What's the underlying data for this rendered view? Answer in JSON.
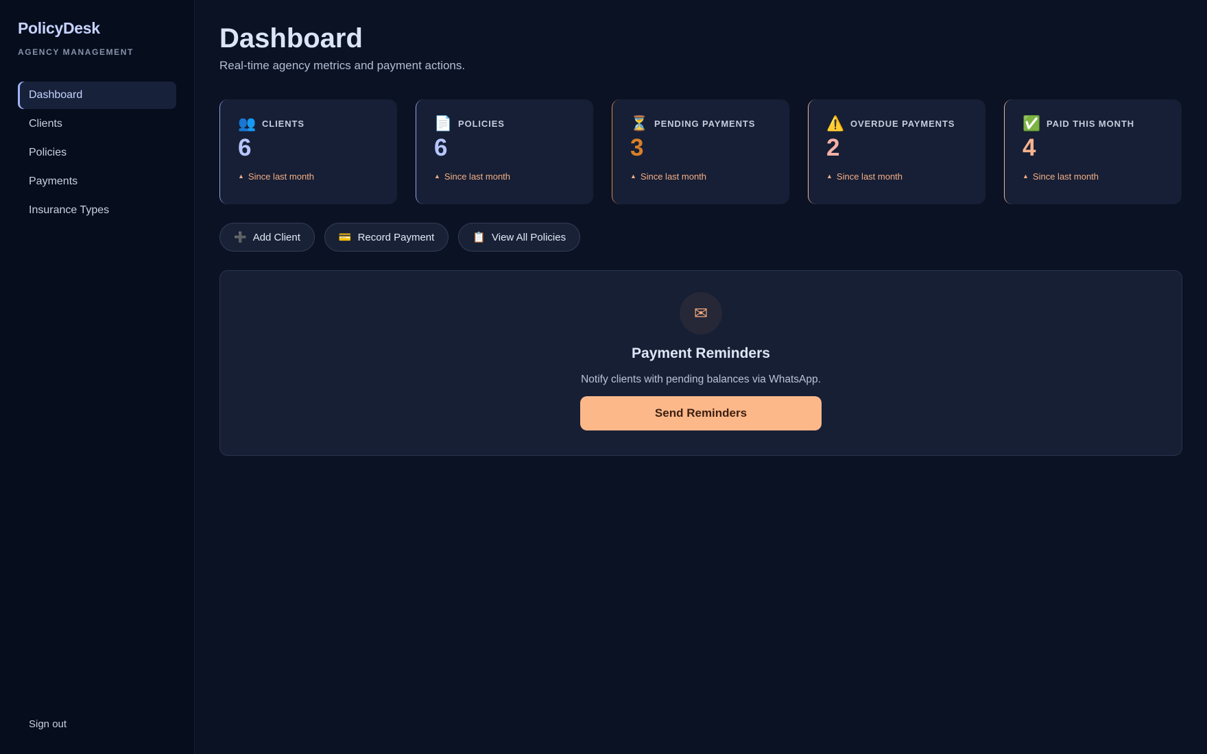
{
  "sidebar": {
    "brand_title": "PolicyDesk",
    "brand_subtitle": "AGENCY MANAGEMENT",
    "items": [
      {
        "label": "Dashboard",
        "active": true
      },
      {
        "label": "Clients"
      },
      {
        "label": "Policies"
      },
      {
        "label": "Payments"
      },
      {
        "label": "Insurance Types"
      }
    ],
    "signout_label": "Sign out"
  },
  "header": {
    "title": "Dashboard",
    "subtitle": "Real-time agency metrics and payment actions."
  },
  "cards": [
    {
      "icon": "👥",
      "icon_name": "clients-icon",
      "label": "CLIENTS",
      "value": "6",
      "trend_icon": "▲",
      "trend": "Since last month",
      "accent": "#8fa4e6"
    },
    {
      "icon": "📄",
      "icon_name": "document-icon",
      "label": "POLICIES",
      "value": "6",
      "trend_icon": "▲",
      "trend": "Since last month",
      "accent": "#8fa4e6"
    },
    {
      "icon": "⏳",
      "icon_name": "hourglass-icon",
      "label": "PENDING PAYMENTS",
      "value": "3",
      "trend_icon": "▲",
      "trend": "Since last month",
      "accent": "#d68b4a"
    },
    {
      "icon": "⚠️",
      "icon_name": "warning-icon",
      "label": "OVERDUE PAYMENTS",
      "value": "2",
      "trend_icon": "▲",
      "trend": "Since last month",
      "accent": "#f1b49a"
    },
    {
      "icon": "✅",
      "icon_name": "check-icon",
      "label": "PAID THIS MONTH",
      "value": "4",
      "trend_icon": "▲",
      "trend": "Since last month",
      "accent": "#f1b49a"
    }
  ],
  "actions": [
    {
      "icon": "➕",
      "label": "Add Client"
    },
    {
      "icon": "💳",
      "label": "Record Payment"
    },
    {
      "icon": "📋",
      "label": "View All Policies"
    }
  ],
  "reminder": {
    "icon": "✉",
    "title": "Payment Reminders",
    "description": "Notify clients with pending balances via WhatsApp.",
    "button_label": "Send Reminders"
  },
  "colors": {
    "background": "#0b1224",
    "sidebar": "#060d1d",
    "card": "#161f35",
    "accent_blue": "#b7c5ff",
    "accent_orange": "#d97f28",
    "accent_pink": "#f5b1a8",
    "accent_peach": "#f7b38f",
    "cta": "#fdb88a"
  }
}
